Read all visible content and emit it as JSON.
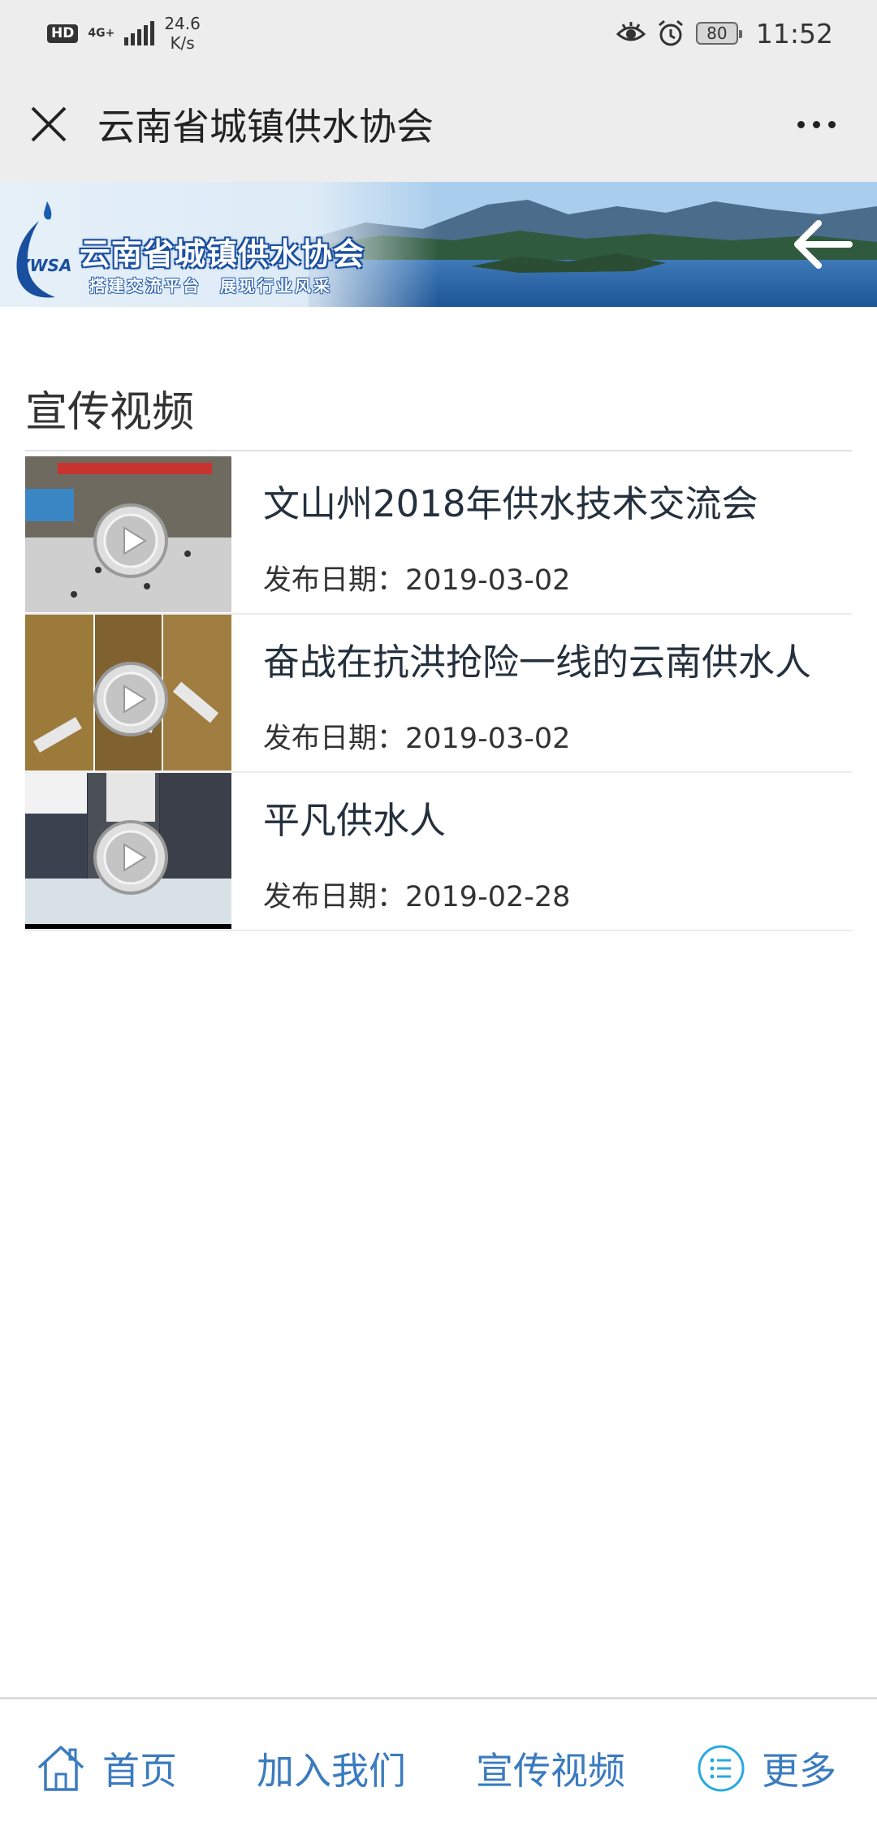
{
  "status_bar": {
    "network_badge": "HD",
    "network_type": "4G+",
    "speed_value": "24.6",
    "speed_unit": "K/s",
    "battery": "80",
    "time": "11:52",
    "icons": [
      "eye-icon",
      "alarm-icon",
      "battery-icon"
    ]
  },
  "titlebar": {
    "title": "云南省城镇供水协会",
    "icons": [
      "close-icon",
      "more-icon"
    ]
  },
  "banner": {
    "logo_abbr": "YWSA",
    "logo_name": "云南省城镇供水协会",
    "slogan": "搭建交流平台　展现行业风采",
    "icons": [
      "back-arrow-icon"
    ]
  },
  "section": {
    "title": "宣传视频"
  },
  "videos": [
    {
      "title": "文山州2018年供水技术交流会",
      "date": "发布日期：2019-03-02"
    },
    {
      "title": "奋战在抗洪抢险一线的云南供水人",
      "date": "发布日期：2019-03-02"
    },
    {
      "title": "平凡供水人",
      "date": "发布日期：2019-02-28"
    }
  ],
  "bottom_nav": {
    "home": "首页",
    "join": "加入我们",
    "video": "宣传视频",
    "more": "更多",
    "accent": "#3b7bbf"
  }
}
